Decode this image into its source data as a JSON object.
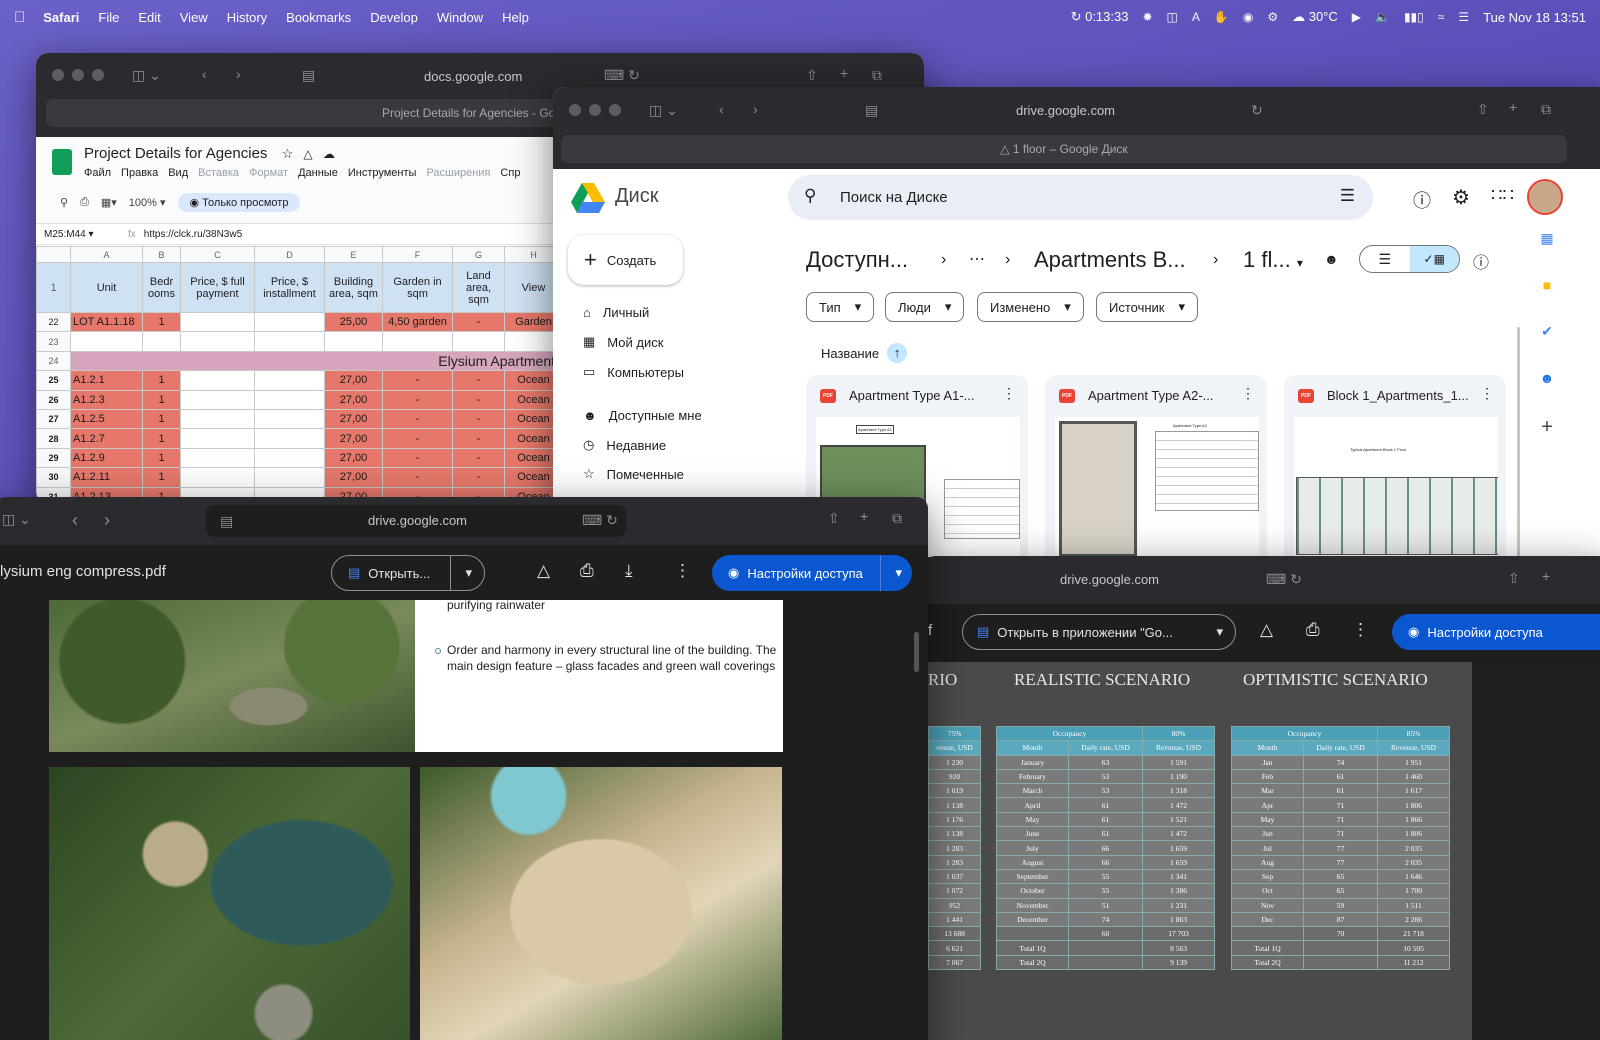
{
  "menubar": {
    "app": "Safari",
    "items": [
      "File",
      "Edit",
      "View",
      "History",
      "Bookmarks",
      "Develop",
      "Window",
      "Help"
    ],
    "timer": "0:13:33",
    "temp": "30°C",
    "datetime": "Tue Nov 18  13:51"
  },
  "sheets": {
    "url": "docs.google.com",
    "tab": "Project Details for Agencies - Google",
    "title": "Project Details for Agencies",
    "menu": [
      "Файл",
      "Правка",
      "Вид",
      "Вставка",
      "Формат",
      "Данные",
      "Инструменты",
      "Расширения",
      "Спр"
    ],
    "zoom": "100%",
    "view_only": "Только просмотр",
    "cell_ref": "M25:M44",
    "formula": "https://clck.ru/38N3w5",
    "letters": [
      "A",
      "B",
      "C",
      "D",
      "E",
      "F",
      "G",
      "H"
    ],
    "headers": [
      "Unit",
      "Bedr ooms",
      "Price, $ full payment",
      "Price, $ installment",
      "Building area, sqm",
      "Garden in sqm",
      "Land area, sqm",
      "View"
    ],
    "row22": {
      "n": "22",
      "unit": "LOT A1.1.18",
      "bed": "1",
      "area": "25,00",
      "garden": "4,50 garden",
      "land": "-",
      "view": "Garden"
    },
    "section": "Elysium Apartments",
    "rows": [
      {
        "n": "25",
        "unit": "A1.2.1"
      },
      {
        "n": "26",
        "unit": "A1.2.3"
      },
      {
        "n": "27",
        "unit": "A1.2.5"
      },
      {
        "n": "28",
        "unit": "A1.2.7"
      },
      {
        "n": "29",
        "unit": "A1.2.9"
      },
      {
        "n": "30",
        "unit": "A1.2.11"
      },
      {
        "n": "31",
        "unit": "A1.2.13"
      }
    ],
    "row_bed": "1",
    "row_area": "27,00",
    "row_dash": "-",
    "row_view": "Ocean"
  },
  "drive": {
    "url": "drive.google.com",
    "tab": "1 floor – Google Диск",
    "logo": "Диск",
    "search": "Поиск на Диске",
    "create": "Создать",
    "nav": [
      "Личный",
      "Мой диск",
      "Компьютеры",
      "Доступные мне",
      "Недавние",
      "Помеченные"
    ],
    "crumbs": [
      "Доступн...",
      "Apartments B...",
      "1 fl..."
    ],
    "chips": [
      "Тип",
      "Люди",
      "Изменено",
      "Источник"
    ],
    "sort": "Название",
    "files": [
      "Apartment Type A1-...",
      "Apartment Type A2-...",
      "Block 1_Apartments_1..."
    ],
    "thumb_a1": "Apartment Type A1",
    "thumb_a2": "Apartment Type A2",
    "thumb_b1": "Typical Apartment Block 1 Floor"
  },
  "pdf": {
    "url": "drive.google.com",
    "name": "lysium eng compress.pdf",
    "open": "Открыть...",
    "share": "Настройки доступа",
    "text1": "purifying rainwater",
    "text2": "Order and harmony in every structural line of the building. The main design feature – glass facades and green wall coverings"
  },
  "scenario": {
    "url": "drive.google.com",
    "open": "Открыть в приложении \"Go...",
    "share": "Настройки доступа",
    "left_cut": "f",
    "titles": [
      "RIO",
      "REALISTIC SCENARIO",
      "OPTIMISTIC SCENARIO"
    ],
    "occ_label": "Occupancy",
    "cols": [
      "Month",
      "Daily rate, USD",
      "Revenue, USD"
    ],
    "left": {
      "occ": "75%",
      "col": "venue, USD",
      "vals": [
        "1 230",
        "920",
        "1 019",
        "1 138",
        "1 176",
        "1 138",
        "1 283",
        "1 283",
        "1 037",
        "1 072",
        "952",
        "1 441",
        "13 688",
        "6 621",
        "7 067"
      ]
    },
    "realistic": {
      "occ": "80%",
      "months": [
        "January",
        "February",
        "March",
        "April",
        "May",
        "June",
        "July",
        "August",
        "September",
        "October",
        "November",
        "December"
      ],
      "rates": [
        "63",
        "53",
        "53",
        "61",
        "61",
        "61",
        "66",
        "66",
        "55",
        "55",
        "51",
        "74"
      ],
      "rev": [
        "1 591",
        "1 190",
        "1 318",
        "1 472",
        "1 521",
        "1 472",
        "1 659",
        "1 659",
        "1 341",
        "1 386",
        "1 231",
        "1 863"
      ],
      "avg": "60",
      "total": "17 703",
      "q1": "Total 1Q",
      "q1v": "8 563",
      "q2": "Total 2Q",
      "q2v": "9 139"
    },
    "optimistic": {
      "occ": "85%",
      "months": [
        "Jan",
        "Feb",
        "Mar",
        "Apr",
        "May",
        "Jun",
        "Jul",
        "Aug",
        "Sep",
        "Oct",
        "Nov",
        "Dec"
      ],
      "rates": [
        "74",
        "61",
        "61",
        "71",
        "71",
        "71",
        "77",
        "77",
        "65",
        "65",
        "59",
        "87"
      ],
      "rev": [
        "1 951",
        "1 460",
        "1 617",
        "1 806",
        "1 866",
        "1 806",
        "2 035",
        "2 035",
        "1 646",
        "1 700",
        "1 511",
        "2 286"
      ],
      "avg": "70",
      "total": "21 718",
      "q1": "Total 1Q",
      "q1v": "10 505",
      "q2": "Total 2Q",
      "q2v": "11 212"
    }
  }
}
